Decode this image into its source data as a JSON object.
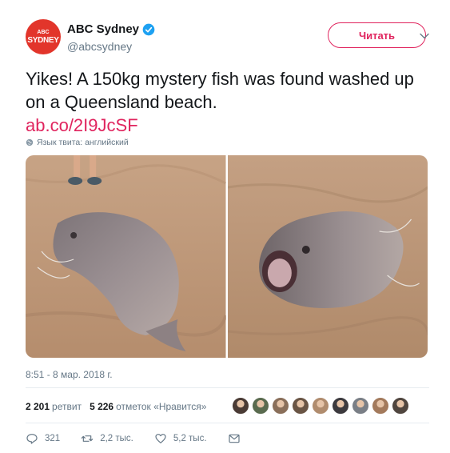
{
  "account": {
    "avatar_top": "ABC",
    "avatar_bottom": "SYDNEY",
    "display_name": "ABC Sydney",
    "handle": "@abcsydney",
    "verified": true
  },
  "follow_button": {
    "label": "Читать",
    "color": "#e0245e"
  },
  "tweet": {
    "text": "Yikes! A 150kg mystery fish was found washed up on a Queensland beach.",
    "link": "ab.co/2I9JcSF",
    "language_note": "Язык твита: английский"
  },
  "media": [
    {
      "icon": "photo-fish-beach-with-feet"
    },
    {
      "icon": "photo-fish-head-closeup"
    }
  ],
  "timestamp": "8:51 - 8 мар. 2018 г.",
  "stats": {
    "retweets_count": "2 201",
    "retweets_label": "ретвит",
    "likes_count": "5 226",
    "likes_label": "отметок «Нравится»",
    "liker_colors": [
      "#4a3b35",
      "#5a6b4f",
      "#8a6f5a",
      "#6a5545",
      "#b08c6e",
      "#3c3a3e",
      "#7a7f86",
      "#a37a5c",
      "#50463f"
    ]
  },
  "actions": {
    "reply_count": "321",
    "retweet_count": "2,2 тыс.",
    "like_count": "5,2 тыс."
  },
  "colors": {
    "accent": "#e0245e",
    "verified": "#1da1f2",
    "muted": "#657786",
    "text": "#14171a"
  }
}
